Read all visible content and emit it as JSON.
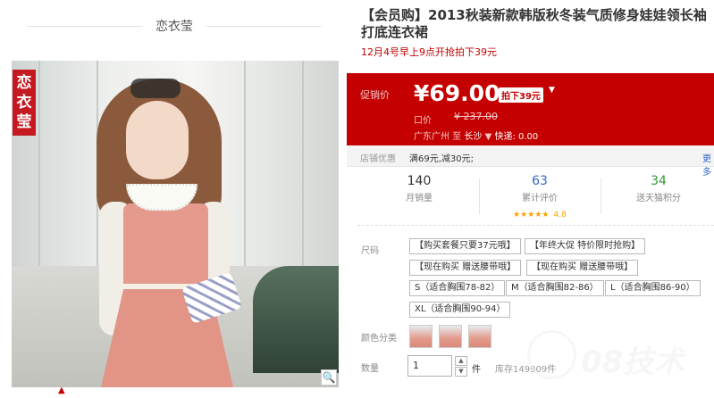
{
  "store": {
    "name": "恋衣莹",
    "brand_tag": "恋衣莹"
  },
  "product": {
    "title": "【会员购】2013秋装新款韩版秋冬装气质修身娃娃领长袖打底连衣裙",
    "subtitle": "12月4号早上9点开抢拍下39元"
  },
  "price": {
    "label": "促销价",
    "value": "¥69.00",
    "badge": "拍下39元",
    "dropdown": "▼",
    "original_label": "口价",
    "original_value": "¥ 237.00",
    "ship_from": "广东广州",
    "ship_to_word": "至",
    "ship_to": "长沙",
    "ship_arrow": "▼",
    "express": "快递: 0.00"
  },
  "promo": {
    "label": "店铺优惠",
    "text": "满69元,减30元;",
    "more": "更多"
  },
  "stats": [
    {
      "num": "140",
      "label": "月销量",
      "color": "#333333"
    },
    {
      "num": "63",
      "label": "累计评价",
      "stars": "★★★★★",
      "rating": "4.8",
      "color": "#3366cc"
    },
    {
      "num": "34",
      "label": "送天猫积分",
      "color": "#339933"
    }
  ],
  "sku": {
    "label": "尺码",
    "options": [
      "【购买套餐只要37元哦】",
      "【年终大促 特价限时抢购】",
      "【现在购买 赠送腰带哦】",
      "【现在购买 赠送腰带哦】",
      "S（适合胸围78-82）",
      "M（适合胸围82-86）",
      "L（适合胸围86-90）",
      "XL（适合胸围90-94）"
    ]
  },
  "color": {
    "label": "颜色分类",
    "swatches": 3
  },
  "quantity": {
    "label": "数量",
    "value": "1",
    "unit": "件",
    "stock": "库存149909件",
    "up": "▲",
    "down": "▼"
  },
  "watermark": {
    "text": "08技术"
  },
  "icons": {
    "zoom": "magnifier-icon",
    "scroll_up": "chevron-up-icon"
  },
  "colors": {
    "accent": "#c40000",
    "link": "#3366cc",
    "rating": "#f7a400"
  }
}
